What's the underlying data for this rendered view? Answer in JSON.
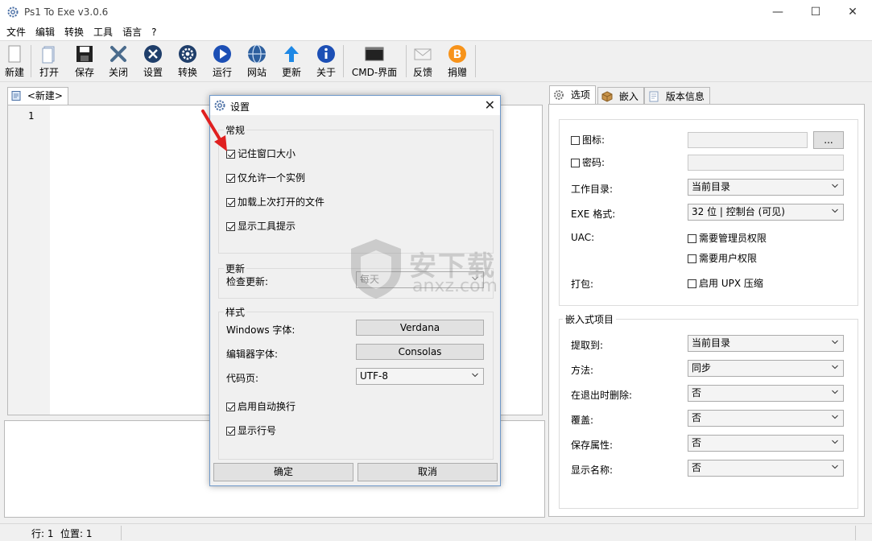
{
  "window": {
    "title": "Ps1 To Exe v3.0.6",
    "minimize": "—",
    "maximize": "☐",
    "close": "✕"
  },
  "menu": [
    "文件",
    "编辑",
    "转换",
    "工具",
    "语言",
    "?"
  ],
  "toolbar": {
    "new": "新建",
    "open": "打开",
    "save": "保存",
    "close": "关闭",
    "settings": "设置",
    "convert": "转换",
    "run": "运行",
    "website": "网站",
    "update": "更新",
    "about": "关于",
    "cmd": "CMD-界面",
    "feedback": "反馈",
    "donate": "捐赠"
  },
  "editor": {
    "tab_label": "<新建>",
    "line_number": "1"
  },
  "statusbar": {
    "line": "行: 1",
    "position": "位置: 1"
  },
  "right_panel": {
    "tabs": [
      "选项",
      "嵌入",
      "版本信息"
    ],
    "options": {
      "icon_label": "图标:",
      "icon_browse": "...",
      "password_label": "密码:",
      "workdir_label": "工作目录:",
      "workdir_value": "当前目录",
      "exe_format_label": "EXE 格式:",
      "exe_format_value": "32 位 | 控制台 (可见)",
      "uac_label": "UAC:",
      "uac_admin": "需要管理员权限",
      "uac_user": "需要用户权限",
      "pack_label": "打包:",
      "pack_upx": "启用 UPX 压缩"
    },
    "embedded": {
      "title": "嵌入式项目",
      "extract_label": "提取到:",
      "extract_value": "当前目录",
      "method_label": "方法:",
      "method_value": "同步",
      "delete_label": "在退出时删除:",
      "delete_value": "否",
      "overwrite_label": "覆盖:",
      "overwrite_value": "否",
      "keep_attr_label": "保存属性:",
      "keep_attr_value": "否",
      "show_name_label": "显示名称:",
      "show_name_value": "否"
    }
  },
  "dialog": {
    "title": "设置",
    "close": "✕",
    "general": {
      "title": "常规",
      "remember_size": "记住窗口大小",
      "single_instance": "仅允许一个实例",
      "load_last": "加载上次打开的文件",
      "show_tooltips": "显示工具提示"
    },
    "update": {
      "title": "更新",
      "check_label": "检查更新:",
      "check_value": "每天"
    },
    "style": {
      "title": "样式",
      "windows_font_label": "Windows 字体:",
      "windows_font_value": "Verdana",
      "editor_font_label": "编辑器字体:",
      "editor_font_value": "Consolas",
      "codepage_label": "代码页:",
      "codepage_value": "UTF-8",
      "word_wrap": "启用自动换行",
      "show_line_numbers": "显示行号"
    },
    "ok": "确定",
    "cancel": "取消"
  },
  "watermark": {
    "text": "安下载",
    "sub": "anxz.com"
  },
  "colors": {
    "dialog_border": "#6e98c9",
    "accent_blue": "#1f5fbf",
    "arrow_red": "#e02020"
  }
}
